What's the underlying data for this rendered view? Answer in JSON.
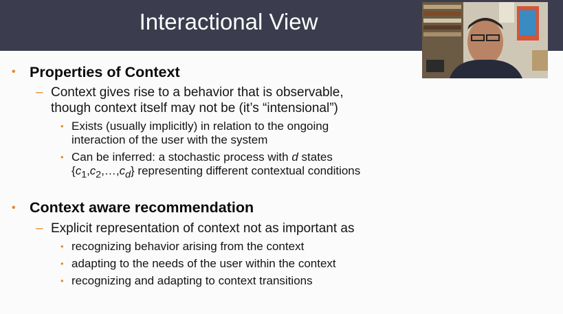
{
  "slide": {
    "title": "Interactional View",
    "section1": {
      "heading": "Properties of Context",
      "sub": {
        "line1": "Context gives rise to a behavior that is observable,",
        "line2": "though context itself may not be (it’s “intensional”)"
      },
      "items": [
        {
          "line1": "Exists (usually implicitly) in relation to the ongoing",
          "line2": "interaction of the user with the system"
        },
        {
          "line1_pre": "Can be inferred: a stochastic process with ",
          "line1_var": "d",
          "line1_post": " states",
          "line2_open": "{",
          "c": "c",
          "sub1": "1",
          "sub2": "2",
          "subd": "d",
          "comma": ",",
          "ellipsis": "…",
          "line2_close": "}",
          "line2_rest": " representing different contextual conditions"
        }
      ]
    },
    "section2": {
      "heading": "Context aware recommendation",
      "sub": "Explicit representation of context not as important as",
      "items": [
        "recognizing behavior arising from the context",
        "adapting to the needs of the user within the context",
        "recognizing and adapting to context transitions"
      ]
    }
  },
  "glyphs": {
    "bullet": "•",
    "dash": "–"
  },
  "colors": {
    "title_bar": "#3b3d4e",
    "accent": "#e58b2c",
    "text": "#141414"
  }
}
